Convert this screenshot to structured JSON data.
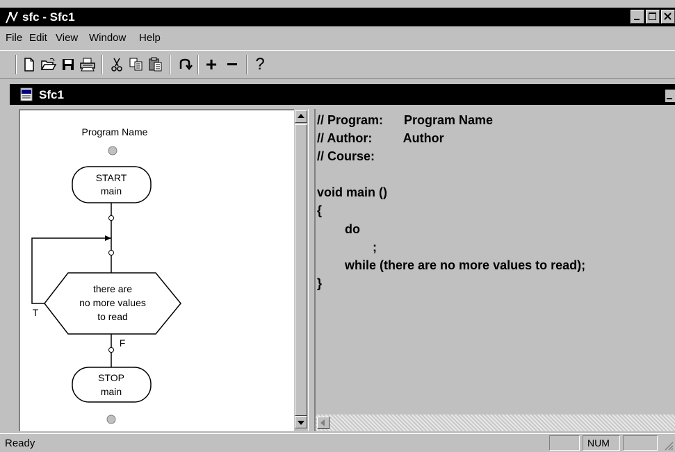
{
  "app": {
    "title": "sfc - Sfc1"
  },
  "menu": {
    "items": [
      "File",
      "Edit",
      "View",
      "Window",
      "Help"
    ]
  },
  "toolbar": {
    "buttons": [
      "new-icon",
      "open-icon",
      "save-icon",
      "print-icon",
      "cut-icon",
      "copy-icon",
      "paste-icon",
      "undo-icon",
      "add-icon",
      "remove-icon",
      "help-icon"
    ],
    "plus": "+",
    "minus": "−",
    "help": "?"
  },
  "child": {
    "title": "Sfc1"
  },
  "flowchart": {
    "program_name": "Program Name",
    "start_line1": "START",
    "start_line2": "main",
    "decision_line1": "there are",
    "decision_line2": "no more values",
    "decision_line3": "to read",
    "true_label": "T",
    "false_label": "F",
    "stop_line1": "STOP",
    "stop_line2": "main"
  },
  "code": {
    "lines": [
      "// Program:      Program Name",
      "// Author:         Author",
      "// Course:",
      "",
      "void main ()",
      "{",
      "        do",
      "                ;",
      "        while (there are no more values to read);",
      "}"
    ]
  },
  "status": {
    "text": "Ready",
    "num": "NUM"
  },
  "colors": {
    "title_bar": "#000000",
    "face": "#c0c0c0"
  }
}
